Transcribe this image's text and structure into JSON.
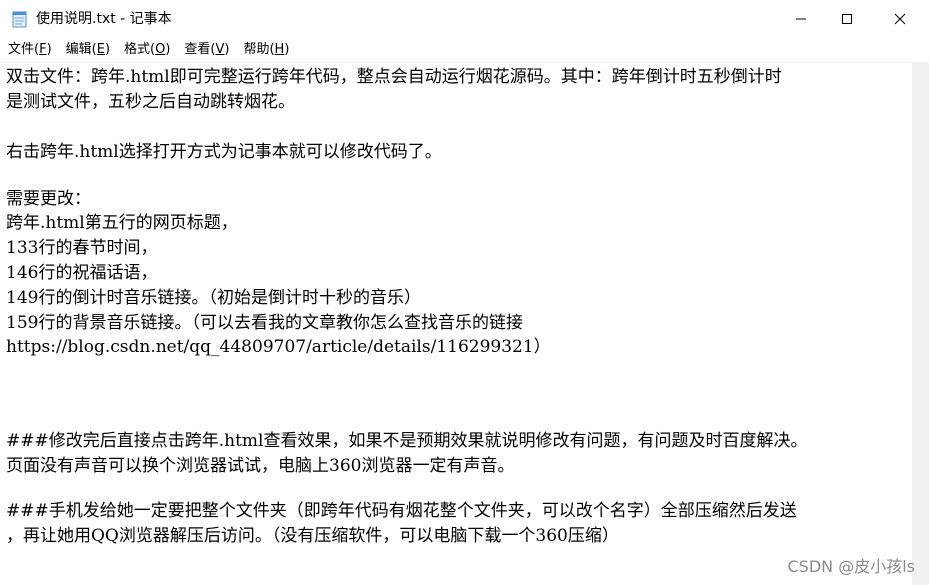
{
  "window": {
    "title": "使用说明.txt - 记事本",
    "icon": "notepad-icon",
    "controls": {
      "minimize": "minimize-icon",
      "maximize": "maximize-icon",
      "close": "close-icon"
    }
  },
  "menu": {
    "items": [
      {
        "label": "文件(",
        "mnemonic": "F",
        "suffix": ")"
      },
      {
        "label": "编辑(",
        "mnemonic": "E",
        "suffix": ")"
      },
      {
        "label": "格式(",
        "mnemonic": "O",
        "suffix": ")"
      },
      {
        "label": "查看(",
        "mnemonic": "V",
        "suffix": ")"
      },
      {
        "label": "帮助(",
        "mnemonic": "H",
        "suffix": ")"
      }
    ]
  },
  "document": {
    "lines": [
      "双击文件：跨年.html即可完整运行跨年代码，整点会自动运行烟花源码。其中：跨年倒计时五秒倒计时",
      "是测试文件，五秒之后自动跳转烟花。",
      "",
      "右击跨年.html选择打开方式为记事本就可以修改代码了。",
      "",
      "需要更改：",
      "跨年.html第五行的网页标题，",
      "133行的春节时间，",
      "146行的祝福话语，",
      "149行的倒计时音乐链接。（初始是倒计时十秒的音乐）",
      "159行的背景音乐链接。（可以去看我的文章教你怎么查找音乐的链接",
      "https://blog.csdn.net/qq_44809707/article/details/116299321）",
      "",
      "",
      "",
      "###修改完后直接点击跨年.html查看效果，如果不是预期效果就说明修改有问题，有问题及时百度解决。",
      "页面没有声音可以换个浏览器试试，电脑上360浏览器一定有声音。",
      "",
      "###手机发给她一定要把整个文件夹（即跨年代码有烟花整个文件夹，可以改个名字）全部压缩然后发送",
      "，再让她用QQ浏览器解压后访问。（没有压缩软件，可以电脑下载一个360压缩）"
    ]
  },
  "watermark": "CSDN @皮小孩ls",
  "colors": {
    "background": "#ffffff",
    "text": "#000000",
    "scrollbar": "#f0f0f0",
    "watermark": "#8a8a8a"
  }
}
